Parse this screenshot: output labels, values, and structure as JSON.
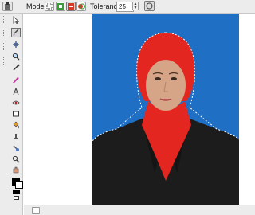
{
  "top_bar": {
    "mode_label": "Mode",
    "tolerance_label": "Tolerance",
    "tolerance_value": "25"
  },
  "tools": [
    {
      "name": "pointer-icon"
    },
    {
      "name": "brush-icon"
    },
    {
      "name": "crosshair-icon"
    },
    {
      "name": "magnifier-icon"
    },
    {
      "name": "eyedropper-icon"
    },
    {
      "name": "pen-tool-icon"
    },
    {
      "name": "text-tool-icon"
    },
    {
      "name": "eye-icon"
    },
    {
      "name": "rectangle-tool-icon"
    },
    {
      "name": "paint-bucket-icon"
    },
    {
      "name": "clone-stamp-icon"
    },
    {
      "name": "smudge-icon"
    },
    {
      "name": "zoom-icon"
    },
    {
      "name": "drawing-hand-icon"
    }
  ],
  "colors": {
    "photo_background": "#1f6fc4",
    "hijab": "#e3261f",
    "jacket": "#1c1c1c",
    "skin": "#d6a486"
  }
}
